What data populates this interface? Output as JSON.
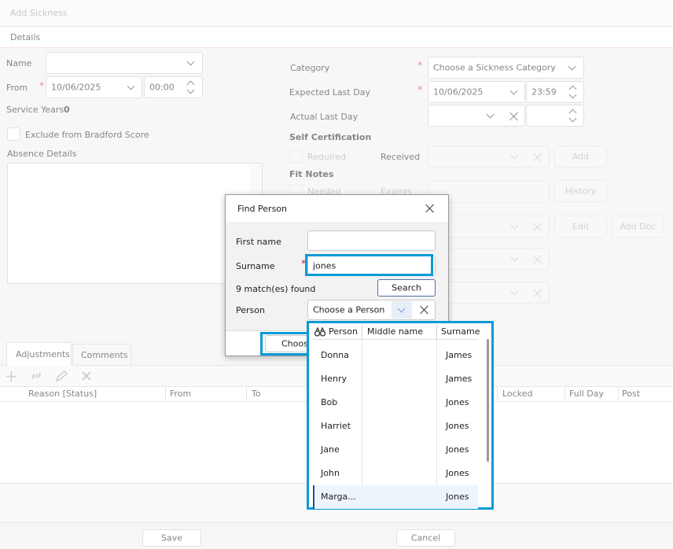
{
  "window": {
    "title": "Add Sickness"
  },
  "sections": {
    "details": "Details"
  },
  "form": {
    "name_label": "Name",
    "from_label": "From",
    "from_date": "10/06/2025",
    "from_time": "00:00",
    "service_years_label": "Service Years",
    "service_years_value": "0",
    "exclude_label": "Exclude from Bradford Score",
    "absence_details_label": "Absence Details",
    "category_label": "Category",
    "category_value": "Choose a Sickness Category",
    "expected_last_day_label": "Expected Last Day",
    "expected_date": "10/06/2025",
    "expected_time": "23:59",
    "actual_last_day_label": "Actual Last Day",
    "self_cert_heading": "Self Certification",
    "required_label": "Required",
    "received_label": "Received",
    "add_button": "Add",
    "fit_notes_heading": "Fit Notes",
    "needed_label": "Needed",
    "expires_label": "Expires",
    "history_button": "History",
    "edit_button": "Edit",
    "add_doc_button": "Add Doc"
  },
  "tabs": [
    {
      "label": "Adjustments"
    },
    {
      "label": "Comments"
    }
  ],
  "grid": {
    "columns": [
      "Reason [Status]",
      "From",
      "To",
      "Locked",
      "Full Day",
      "Post"
    ]
  },
  "footer": {
    "save": "Save",
    "cancel": "Cancel"
  },
  "dialog": {
    "title": "Find Person",
    "first_name_label": "First name",
    "first_name_value": "",
    "surname_label": "Surname",
    "surname_value": "jones",
    "match_count": "9 match(es) found",
    "search_button": "Search",
    "person_label": "Person",
    "person_placeholder": "Choose a Person",
    "choose_button": "Choose"
  },
  "dropdown": {
    "columns": [
      "Person",
      "Middle name",
      "Surname"
    ],
    "rows": [
      {
        "person": "Donna",
        "middle": "",
        "surname": "James"
      },
      {
        "person": "Henry",
        "middle": "",
        "surname": "James"
      },
      {
        "person": "Bob",
        "middle": "",
        "surname": "Jones"
      },
      {
        "person": "Harriet",
        "middle": "",
        "surname": "Jones"
      },
      {
        "person": "Jane",
        "middle": "",
        "surname": "Jones"
      },
      {
        "person": "John",
        "middle": "",
        "surname": "Jones"
      },
      {
        "person": "Marga...",
        "middle": "",
        "surname": "Jones"
      }
    ]
  },
  "colors": {
    "highlight": "#0a9bd6",
    "required": "#dd2222"
  }
}
